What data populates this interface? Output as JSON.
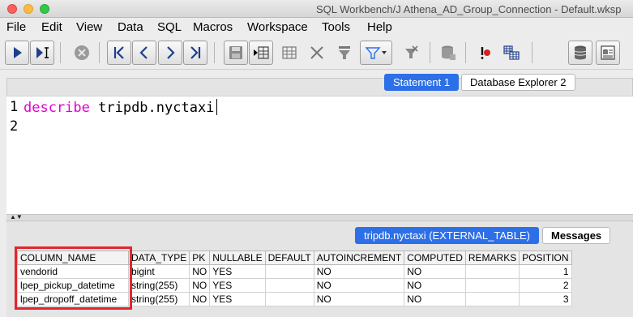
{
  "window": {
    "title": "SQL Workbench/J Athena_AD_Group_Connection - Default.wksp"
  },
  "menu": [
    "File",
    "Edit",
    "View",
    "Data",
    "SQL",
    "Macros",
    "Workspace",
    "Tools",
    "Help"
  ],
  "toolbar": {
    "icons": [
      "execute-icon",
      "execute-current-icon",
      "stop-icon",
      "first-icon",
      "previous-icon",
      "next-icon",
      "last-icon",
      "save-icon",
      "insert-row-icon",
      "copy-row-icon",
      "delete-row-icon",
      "filter-icon",
      "filter-dropdown-icon",
      "reset-filter-icon",
      "database-save-icon",
      "exception-icon",
      "object-finder-icon",
      "connect-icon",
      "db-explorer-icon"
    ]
  },
  "editor_tabs": {
    "statement": "Statement 1",
    "explorer": "Database Explorer 2"
  },
  "editor": {
    "line_numbers": [
      "1",
      "2"
    ],
    "keyword": "describe",
    "code_rest": " tripdb.nyctaxi"
  },
  "result_tabs": {
    "result": "tripdb.nyctaxi (EXTERNAL_TABLE)",
    "messages": "Messages"
  },
  "table": {
    "columns": [
      "COLUMN_NAME",
      "DATA_TYPE",
      "PK",
      "NULLABLE",
      "DEFAULT",
      "AUTOINCREMENT",
      "COMPUTED",
      "REMARKS",
      "POSITION"
    ],
    "rows": [
      [
        "vendorid",
        "bigint",
        "NO",
        "YES",
        "",
        "NO",
        "NO",
        "",
        "1"
      ],
      [
        "lpep_pickup_datetime",
        "string(255)",
        "NO",
        "YES",
        "",
        "NO",
        "NO",
        "",
        "2"
      ],
      [
        "lpep_dropoff_datetime",
        "string(255)",
        "NO",
        "YES",
        "",
        "NO",
        "NO",
        "",
        "3"
      ]
    ]
  },
  "colors": {
    "accent": "#2d6fe6",
    "keyword": "#e000d0",
    "highlight": "#e0262f"
  }
}
